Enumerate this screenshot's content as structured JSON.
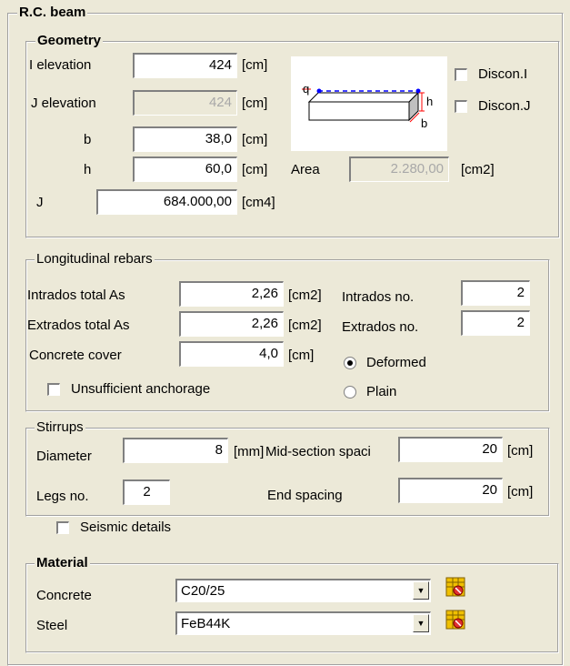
{
  "panel": {
    "title": "R.C. beam"
  },
  "geometry": {
    "title": "Geometry",
    "i_elevation": {
      "label": "I elevation",
      "value": "424",
      "unit": "[cm]"
    },
    "j_elevation": {
      "label": "J elevation",
      "value": "424",
      "unit": "[cm]"
    },
    "b": {
      "label": "b",
      "value": "38,0",
      "unit": "[cm]"
    },
    "h": {
      "label": "h",
      "value": "60,0",
      "unit": "[cm]"
    },
    "area": {
      "label": "Area",
      "value": "2.280,00",
      "unit": "[cm2]"
    },
    "j": {
      "label": "J",
      "value": "684.000,00",
      "unit": "[cm4]"
    },
    "discon_i": {
      "label": "Discon.I",
      "checked": false
    },
    "discon_j": {
      "label": "Discon.J",
      "checked": false
    },
    "diagram": {
      "q": "q",
      "h": "h",
      "b": "b"
    }
  },
  "longitudinal": {
    "title": "Longitudinal rebars",
    "intrados_total": {
      "label": "Intrados total As",
      "value": "2,26",
      "unit": "[cm2]"
    },
    "extrados_total": {
      "label": "Extrados total As",
      "value": "2,26",
      "unit": "[cm2]"
    },
    "cover": {
      "label": "Concrete cover",
      "value": "4,0",
      "unit": "[cm]"
    },
    "intrados_no": {
      "label": "Intrados no.",
      "value": "2"
    },
    "extrados_no": {
      "label": "Extrados no.",
      "value": "2"
    },
    "deformed": {
      "label": "Deformed",
      "selected": true
    },
    "plain": {
      "label": "Plain",
      "selected": false
    },
    "unsufficient": {
      "label": "Unsufficient anchorage",
      "checked": false
    }
  },
  "stirrups": {
    "title": "Stirrups",
    "diameter": {
      "label": "Diameter",
      "value": "8",
      "unit": "[mm]"
    },
    "mid_spacing": {
      "label": "Mid-section spaci",
      "value": "20",
      "unit": "[cm]"
    },
    "legs": {
      "label": "Legs no.",
      "value": "2"
    },
    "end_spacing": {
      "label": "End spacing",
      "value": "20",
      "unit": "[cm]"
    }
  },
  "seismic": {
    "label": "Seismic details",
    "checked": false
  },
  "material": {
    "title": "Material",
    "concrete": {
      "label": "Concrete",
      "value": "C20/25"
    },
    "steel": {
      "label": "Steel",
      "value": "FeB44K"
    }
  }
}
